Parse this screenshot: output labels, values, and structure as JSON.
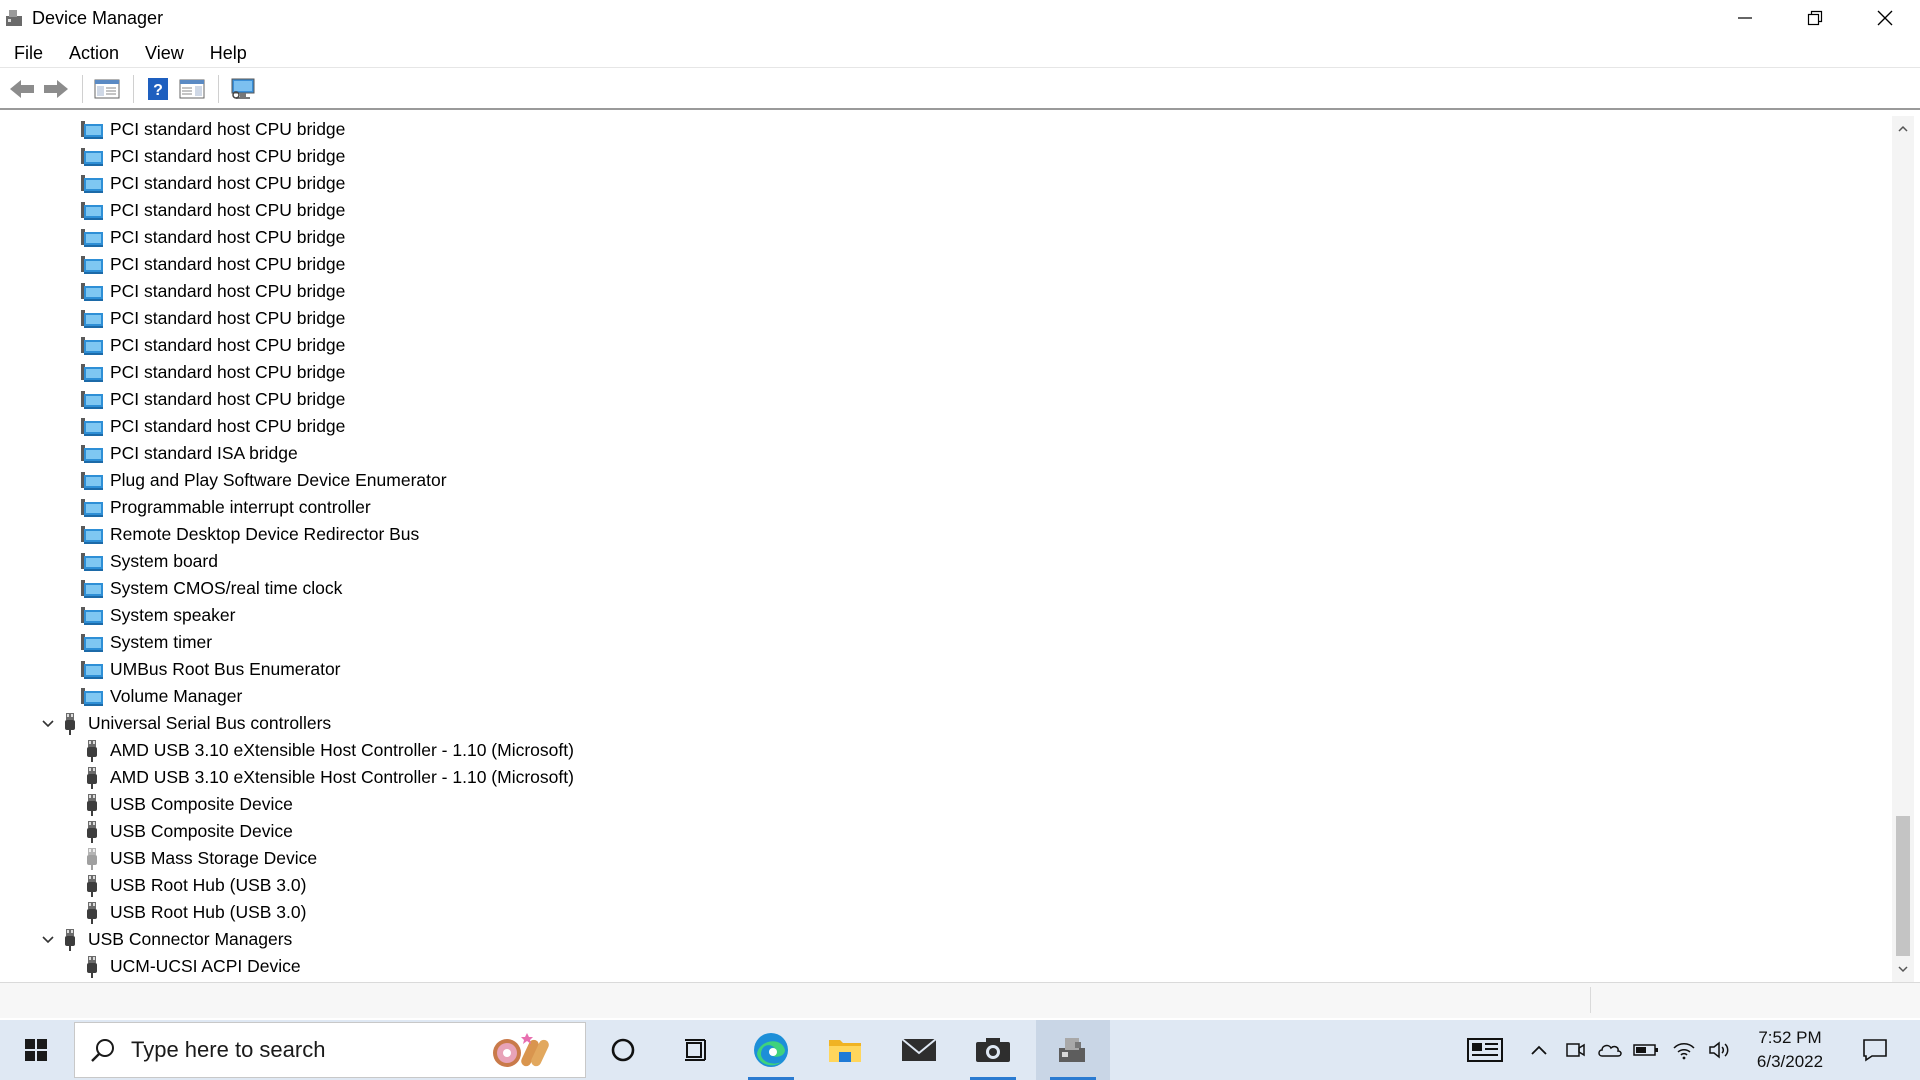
{
  "window": {
    "title": "Device Manager"
  },
  "menu": [
    "File",
    "Action",
    "View",
    "Help"
  ],
  "toolbar": {
    "buttons": [
      "back-arrow-icon",
      "forward-arrow-icon",
      "show-hide-console-tree-icon",
      "help-icon",
      "properties-pane-icon",
      "scan-hardware-monitor-icon"
    ]
  },
  "tree": {
    "items": [
      {
        "label": "PCI standard host CPU bridge",
        "level": 2,
        "icon": "system-device-icon"
      },
      {
        "label": "PCI standard host CPU bridge",
        "level": 2,
        "icon": "system-device-icon"
      },
      {
        "label": "PCI standard host CPU bridge",
        "level": 2,
        "icon": "system-device-icon"
      },
      {
        "label": "PCI standard host CPU bridge",
        "level": 2,
        "icon": "system-device-icon"
      },
      {
        "label": "PCI standard host CPU bridge",
        "level": 2,
        "icon": "system-device-icon"
      },
      {
        "label": "PCI standard host CPU bridge",
        "level": 2,
        "icon": "system-device-icon"
      },
      {
        "label": "PCI standard host CPU bridge",
        "level": 2,
        "icon": "system-device-icon"
      },
      {
        "label": "PCI standard host CPU bridge",
        "level": 2,
        "icon": "system-device-icon"
      },
      {
        "label": "PCI standard host CPU bridge",
        "level": 2,
        "icon": "system-device-icon"
      },
      {
        "label": "PCI standard host CPU bridge",
        "level": 2,
        "icon": "system-device-icon"
      },
      {
        "label": "PCI standard host CPU bridge",
        "level": 2,
        "icon": "system-device-icon"
      },
      {
        "label": "PCI standard host CPU bridge",
        "level": 2,
        "icon": "system-device-icon"
      },
      {
        "label": "PCI standard ISA bridge",
        "level": 2,
        "icon": "system-device-icon"
      },
      {
        "label": "Plug and Play Software Device Enumerator",
        "level": 2,
        "icon": "system-device-icon"
      },
      {
        "label": "Programmable interrupt controller",
        "level": 2,
        "icon": "system-device-icon"
      },
      {
        "label": "Remote Desktop Device Redirector Bus",
        "level": 2,
        "icon": "system-device-icon"
      },
      {
        "label": "System board",
        "level": 2,
        "icon": "system-device-icon"
      },
      {
        "label": "System CMOS/real time clock",
        "level": 2,
        "icon": "system-device-icon"
      },
      {
        "label": "System speaker",
        "level": 2,
        "icon": "system-device-icon"
      },
      {
        "label": "System timer",
        "level": 2,
        "icon": "system-device-icon"
      },
      {
        "label": "UMBus Root Bus Enumerator",
        "level": 2,
        "icon": "system-device-icon"
      },
      {
        "label": "Volume Manager",
        "level": 2,
        "icon": "system-device-icon"
      },
      {
        "label": "Universal Serial Bus controllers",
        "level": 1,
        "icon": "usb-plug-icon",
        "expanded": true
      },
      {
        "label": "AMD USB 3.10 eXtensible Host Controller - 1.10 (Microsoft)",
        "level": 2,
        "icon": "usb-plug-icon"
      },
      {
        "label": "AMD USB 3.10 eXtensible Host Controller - 1.10 (Microsoft)",
        "level": 2,
        "icon": "usb-plug-icon"
      },
      {
        "label": "USB Composite Device",
        "level": 2,
        "icon": "usb-plug-icon"
      },
      {
        "label": "USB Composite Device",
        "level": 2,
        "icon": "usb-plug-icon"
      },
      {
        "label": "USB Mass Storage Device",
        "level": 2,
        "icon": "usb-plug-light-icon"
      },
      {
        "label": "USB Root Hub (USB 3.0)",
        "level": 2,
        "icon": "usb-plug-icon"
      },
      {
        "label": "USB Root Hub (USB 3.0)",
        "level": 2,
        "icon": "usb-plug-icon"
      },
      {
        "label": "USB Connector Managers",
        "level": 1,
        "icon": "usb-plug-icon",
        "expanded": true
      },
      {
        "label": "UCM-UCSI ACPI Device",
        "level": 2,
        "icon": "usb-plug-icon"
      }
    ]
  },
  "taskbar": {
    "search_placeholder": "Type here to search",
    "apps": [
      "cortana-circle-icon",
      "task-view-icon",
      "edge-browser-icon",
      "file-explorer-icon",
      "mail-icon",
      "camera-icon",
      "device-manager-icon"
    ],
    "tray": [
      "news-widget-icon",
      "chevron-up-icon",
      "meet-now-icon",
      "onedrive-cloud-icon",
      "battery-icon",
      "wifi-icon",
      "volume-icon"
    ],
    "time": "7:52 PM",
    "date": "6/3/2022",
    "notification": "action-center-icon"
  },
  "colors": {
    "accent": "#2b7bd1",
    "taskbar_bg": "#dfe8f3",
    "folder_blue": "#3aa0e0"
  }
}
